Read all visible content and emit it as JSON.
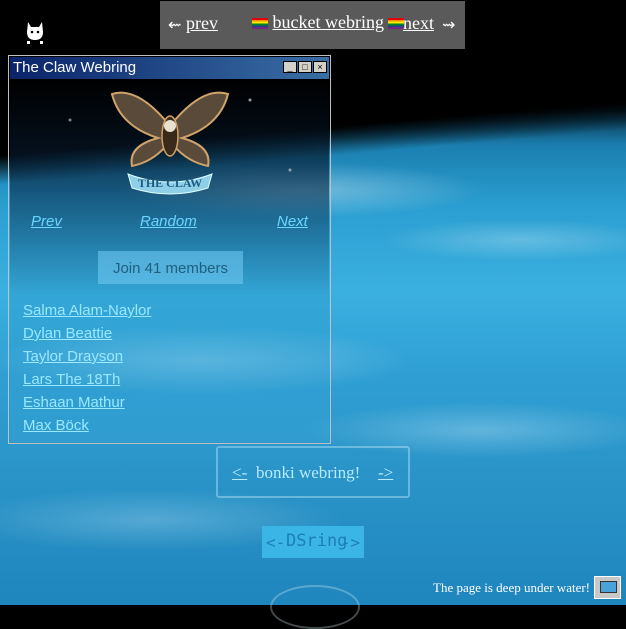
{
  "top_webring": {
    "prev_arrow": "⇜",
    "prev_label": "prev",
    "title": "bucket webring",
    "next_label": "next",
    "next_arrow": "⇝"
  },
  "window": {
    "title": "The Claw Webring",
    "nav": {
      "prev": "Prev",
      "random": "Random",
      "next": "Next"
    },
    "join_label": "Join 41 members",
    "members": [
      "Salma Alam-Naylor",
      "Dylan Beattie",
      "Taylor Drayson",
      "Lars The 18Th",
      "Eshaan Mathur",
      "Max Böck"
    ]
  },
  "bonki": {
    "prev": "<-",
    "title": "bonki webring!",
    "next": "->"
  },
  "dsring": {
    "prev": "<-",
    "title": "DSring",
    "next": "->"
  },
  "footer": {
    "note": "The page is deep under water!"
  }
}
